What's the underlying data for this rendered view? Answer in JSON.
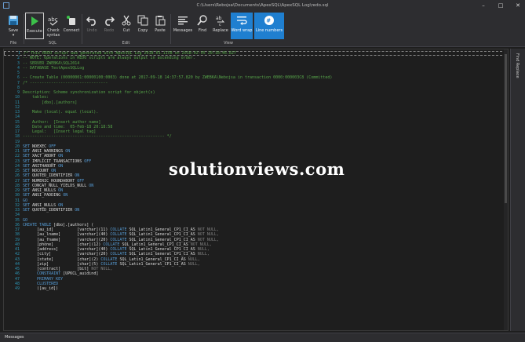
{
  "window": {
    "title_path": "C:\\Users\\Rebojsa\\Documents\\ApexSQL\\ApexSQL Log\\redo.sql",
    "controls": [
      "–",
      "□",
      "✕"
    ]
  },
  "ribbon": {
    "buttons": [
      {
        "id": "save",
        "label": "Save",
        "icon": "save-icon"
      },
      {
        "id": "execute",
        "label": "Execute",
        "icon": "play-icon"
      },
      {
        "id": "check-syntax",
        "label": "Check\nsyntax",
        "icon": "check-syntax-icon"
      },
      {
        "id": "connect",
        "label": "Connect",
        "icon": "connect-icon"
      },
      {
        "id": "undo",
        "label": "Undo",
        "icon": "undo-icon"
      },
      {
        "id": "redo",
        "label": "Redo",
        "icon": "redo-icon"
      },
      {
        "id": "cut",
        "label": "Cut",
        "icon": "cut-icon"
      },
      {
        "id": "copy",
        "label": "Copy",
        "icon": "copy-icon"
      },
      {
        "id": "paste",
        "label": "Paste",
        "icon": "paste-icon"
      },
      {
        "id": "messages",
        "label": "Messages",
        "icon": "messages-icon"
      },
      {
        "id": "find",
        "label": "Find",
        "icon": "find-icon"
      },
      {
        "id": "replace",
        "label": "Replace",
        "icon": "replace-icon"
      },
      {
        "id": "word-wrap",
        "label": "Word wrap",
        "icon": "word-wrap-icon"
      },
      {
        "id": "line-numbers",
        "label": "Line numbers",
        "icon": "line-numbers-icon"
      }
    ],
    "groups": {
      "file": "File",
      "sql": "SQL",
      "edit": "Edit",
      "view": "View"
    }
  },
  "side_panel": {
    "label": "Find Replace"
  },
  "status": {
    "messages_tab": "Messages"
  },
  "watermark": "solutionviews.com",
  "colors": {
    "comment": "#57a64a",
    "keyword": "#569cd6",
    "string": "#d69d85",
    "gray": "#808080",
    "identifier": "#dcdcdc",
    "accent": "#1f7fd0"
  },
  "code_lines": [
    {
      "n": "1",
      "segs": [
        {
          "t": "/* This REDO script was generated with ApexSQL Log 2018.01.1158 on 2018-02-05 20:18:46.827",
          "c": "comment"
        }
      ]
    },
    {
      "n": "2",
      "segs": [
        {
          "t": "-- NOTE: Operations in REDO scripts are always output in ascending order.",
          "c": "comment"
        }
      ]
    },
    {
      "n": "3",
      "segs": [
        {
          "t": "-- SERVER ZWEBKA\\SQL2014",
          "c": "comment"
        }
      ]
    },
    {
      "n": "4",
      "segs": [
        {
          "t": "-- DATABASE TestApexSQLLog",
          "c": "comment"
        }
      ]
    },
    {
      "n": "5",
      "segs": [
        {
          "t": "",
          "c": "identifier"
        }
      ]
    },
    {
      "n": "6",
      "segs": [
        {
          "t": "-- Create Table (00000001:00000100:0003) done at 2017-09-18 14:37:57.820 by ZWEBKA\\Nebojsa in transaction 0000:000003C8 (Committed)",
          "c": "comment"
        }
      ]
    },
    {
      "n": "7",
      "segs": [
        {
          "t": "/* ---------------------------------",
          "c": "comment"
        }
      ]
    },
    {
      "n": "8",
      "segs": [
        {
          "t": "",
          "c": "identifier"
        }
      ]
    },
    {
      "n": "9",
      "segs": [
        {
          "t": "Description: Scheme synchronization script for object(s)",
          "c": "comment"
        }
      ]
    },
    {
      "n": "10",
      "segs": [
        {
          "t": "    tables:",
          "c": "comment"
        }
      ]
    },
    {
      "n": "11",
      "segs": [
        {
          "t": "        [dbo].[authors]",
          "c": "comment"
        }
      ]
    },
    {
      "n": "12",
      "segs": [
        {
          "t": "",
          "c": "identifier"
        }
      ]
    },
    {
      "n": "13",
      "segs": [
        {
          "t": "    Make (local). equal (local).",
          "c": "comment"
        }
      ]
    },
    {
      "n": "14",
      "segs": [
        {
          "t": "",
          "c": "identifier"
        }
      ]
    },
    {
      "n": "15",
      "segs": [
        {
          "t": "    Author:  [Insert author name]",
          "c": "comment"
        }
      ]
    },
    {
      "n": "16",
      "segs": [
        {
          "t": "    Date and time:  05-Feb-18 20:18:58",
          "c": "comment"
        }
      ]
    },
    {
      "n": "17",
      "segs": [
        {
          "t": "    Legal:   [Insert legal tag]",
          "c": "comment"
        }
      ]
    },
    {
      "n": "18",
      "segs": [
        {
          "t": "------------------------------------------------------------ */",
          "c": "comment"
        }
      ]
    },
    {
      "n": "19",
      "segs": [
        {
          "t": "",
          "c": "identifier"
        }
      ]
    },
    {
      "n": "20",
      "segs": [
        {
          "t": "SET ",
          "c": "keyword"
        },
        {
          "t": "NOEXEC ",
          "c": "identifier"
        },
        {
          "t": "OFF",
          "c": "keyword"
        }
      ]
    },
    {
      "n": "21",
      "segs": [
        {
          "t": "SET ",
          "c": "keyword"
        },
        {
          "t": "ANSI_WARNINGS ",
          "c": "identifier"
        },
        {
          "t": "ON",
          "c": "keyword"
        }
      ]
    },
    {
      "n": "22",
      "segs": [
        {
          "t": "SET ",
          "c": "keyword"
        },
        {
          "t": "XACT_ABORT ",
          "c": "identifier"
        },
        {
          "t": "ON",
          "c": "keyword"
        }
      ]
    },
    {
      "n": "23",
      "segs": [
        {
          "t": "SET ",
          "c": "keyword"
        },
        {
          "t": "IMPLICIT_TRANSACTIONS ",
          "c": "identifier"
        },
        {
          "t": "OFF",
          "c": "keyword"
        }
      ]
    },
    {
      "n": "24",
      "segs": [
        {
          "t": "SET ",
          "c": "keyword"
        },
        {
          "t": "ARITHABORT ",
          "c": "identifier"
        },
        {
          "t": "ON",
          "c": "keyword"
        }
      ]
    },
    {
      "n": "25",
      "segs": [
        {
          "t": "SET ",
          "c": "keyword"
        },
        {
          "t": "NOCOUNT ",
          "c": "identifier"
        },
        {
          "t": "ON",
          "c": "keyword"
        }
      ]
    },
    {
      "n": "26",
      "segs": [
        {
          "t": "SET ",
          "c": "keyword"
        },
        {
          "t": "QUOTED_IDENTIFIER ",
          "c": "identifier"
        },
        {
          "t": "ON",
          "c": "keyword"
        }
      ]
    },
    {
      "n": "27",
      "segs": [
        {
          "t": "SET ",
          "c": "keyword"
        },
        {
          "t": "NUMERIC_ROUNDABORT ",
          "c": "identifier"
        },
        {
          "t": "OFF",
          "c": "keyword"
        }
      ]
    },
    {
      "n": "28",
      "segs": [
        {
          "t": "SET ",
          "c": "keyword"
        },
        {
          "t": "CONCAT_NULL_YIELDS_NULL ",
          "c": "identifier"
        },
        {
          "t": "ON",
          "c": "keyword"
        }
      ]
    },
    {
      "n": "29",
      "segs": [
        {
          "t": "SET ",
          "c": "keyword"
        },
        {
          "t": "ANSI_NULLS ",
          "c": "identifier"
        },
        {
          "t": "ON",
          "c": "keyword"
        }
      ]
    },
    {
      "n": "30",
      "segs": [
        {
          "t": "SET ",
          "c": "keyword"
        },
        {
          "t": "ANSI_PADDING ",
          "c": "identifier"
        },
        {
          "t": "ON",
          "c": "keyword"
        }
      ]
    },
    {
      "n": "31",
      "segs": [
        {
          "t": "GO",
          "c": "keyword"
        }
      ]
    },
    {
      "n": "32",
      "segs": [
        {
          "t": "SET ",
          "c": "keyword"
        },
        {
          "t": "ANSI_NULLS ",
          "c": "identifier"
        },
        {
          "t": "ON",
          "c": "keyword"
        }
      ]
    },
    {
      "n": "33",
      "segs": [
        {
          "t": "SET ",
          "c": "keyword"
        },
        {
          "t": "QUOTED_IDENTIFIER ",
          "c": "identifier"
        },
        {
          "t": "ON",
          "c": "keyword"
        }
      ]
    },
    {
      "n": "34",
      "segs": [
        {
          "t": "",
          "c": "identifier"
        }
      ]
    },
    {
      "n": "35",
      "segs": [
        {
          "t": "GO",
          "c": "keyword"
        }
      ]
    },
    {
      "n": "36",
      "segs": [
        {
          "t": "CREATE TABLE ",
          "c": "keyword"
        },
        {
          "t": "[dbo].[authors] (",
          "c": "identifier"
        }
      ]
    },
    {
      "n": "37",
      "segs": [
        {
          "t": "      [au_id]          [varchar](11) ",
          "c": "identifier"
        },
        {
          "t": "COLLATE ",
          "c": "keyword"
        },
        {
          "t": "SQL_Latin1_General_CP1_CI_AS ",
          "c": "identifier"
        },
        {
          "t": "NOT NULL,",
          "c": "gray"
        }
      ]
    },
    {
      "n": "38",
      "segs": [
        {
          "t": "      [au_lname]       [varchar](40) ",
          "c": "identifier"
        },
        {
          "t": "COLLATE ",
          "c": "keyword"
        },
        {
          "t": "SQL_Latin1_General_CP1_CI_AS ",
          "c": "identifier"
        },
        {
          "t": "NOT NULL,",
          "c": "gray"
        }
      ]
    },
    {
      "n": "39",
      "segs": [
        {
          "t": "      [au_fname]       [varchar](20) ",
          "c": "identifier"
        },
        {
          "t": "COLLATE ",
          "c": "keyword"
        },
        {
          "t": "SQL_Latin1_General_CP1_CI_AS ",
          "c": "identifier"
        },
        {
          "t": "NOT NULL,",
          "c": "gray"
        }
      ]
    },
    {
      "n": "40",
      "segs": [
        {
          "t": "      [phone]          [char](12) ",
          "c": "identifier"
        },
        {
          "t": "COLLATE ",
          "c": "keyword"
        },
        {
          "t": "SQL_Latin1_General_CP1_CI_AS ",
          "c": "identifier"
        },
        {
          "t": "NOT NULL,",
          "c": "gray"
        }
      ]
    },
    {
      "n": "41",
      "segs": [
        {
          "t": "      [address]        [varchar](40) ",
          "c": "identifier"
        },
        {
          "t": "COLLATE ",
          "c": "keyword"
        },
        {
          "t": "SQL_Latin1_General_CP1_CI_AS ",
          "c": "identifier"
        },
        {
          "t": "NULL,",
          "c": "gray"
        }
      ]
    },
    {
      "n": "42",
      "segs": [
        {
          "t": "      [city]           [varchar](20) ",
          "c": "identifier"
        },
        {
          "t": "COLLATE ",
          "c": "keyword"
        },
        {
          "t": "SQL_Latin1_General_CP1_CI_AS ",
          "c": "identifier"
        },
        {
          "t": "NULL,",
          "c": "gray"
        }
      ]
    },
    {
      "n": "43",
      "segs": [
        {
          "t": "      [state]          [char](2) ",
          "c": "identifier"
        },
        {
          "t": "COLLATE ",
          "c": "keyword"
        },
        {
          "t": "SQL_Latin1_General_CP1_CI_AS ",
          "c": "identifier"
        },
        {
          "t": "NULL,",
          "c": "gray"
        }
      ]
    },
    {
      "n": "44",
      "segs": [
        {
          "t": "      [zip]            [char](5) ",
          "c": "identifier"
        },
        {
          "t": "COLLATE ",
          "c": "keyword"
        },
        {
          "t": "SQL_Latin1_General_CP1_CI_AS ",
          "c": "identifier"
        },
        {
          "t": "NULL,",
          "c": "gray"
        }
      ]
    },
    {
      "n": "45",
      "segs": [
        {
          "t": "      [contract]       [bit] ",
          "c": "identifier"
        },
        {
          "t": "NOT NULL,",
          "c": "gray"
        }
      ]
    },
    {
      "n": "46",
      "segs": [
        {
          "t": "      CONSTRAINT ",
          "c": "keyword"
        },
        {
          "t": "[UPKCL_auidind]",
          "c": "identifier"
        }
      ]
    },
    {
      "n": "47",
      "segs": [
        {
          "t": "      PRIMARY KEY",
          "c": "keyword"
        }
      ]
    },
    {
      "n": "48",
      "segs": [
        {
          "t": "      CLUSTERED",
          "c": "keyword"
        }
      ]
    },
    {
      "n": "49",
      "segs": [
        {
          "t": "      ([au_id])",
          "c": "identifier"
        }
      ]
    }
  ]
}
